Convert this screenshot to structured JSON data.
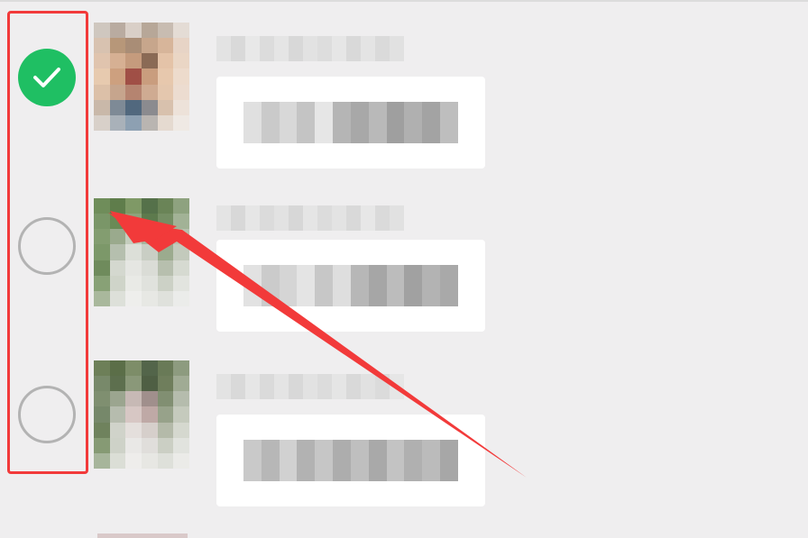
{
  "colors": {
    "background": "#efeeef",
    "check_green": "#1fbf63",
    "radio_gray": "#b3b3b3",
    "annotation_red": "#f23a3a"
  },
  "messages": [
    {
      "selected": true,
      "icon": "checkmark-icon"
    },
    {
      "selected": false,
      "icon": "radio-empty-icon"
    },
    {
      "selected": false,
      "icon": "radio-empty-icon"
    }
  ]
}
